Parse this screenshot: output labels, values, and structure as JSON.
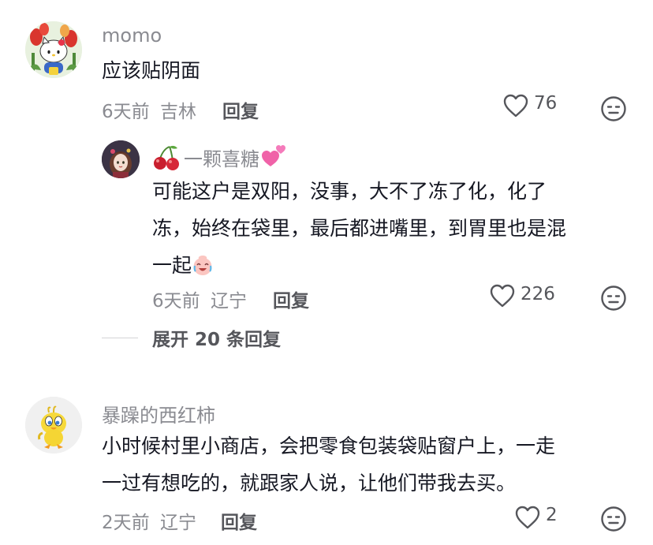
{
  "comments": [
    {
      "username": "momo",
      "text": "应该贴阴面",
      "time": "6天前",
      "location": "吉林",
      "reply_label": "回复",
      "likes": "76",
      "avatar": "hello-kitty-tulip-avatar"
    },
    {
      "username_prefix_icon": "cherry-icon",
      "username": "一颗喜糖",
      "username_suffix_icon": "two-hearts-icon",
      "text_line1": "可能这户是双阳，没事，大不了冻了化，化了",
      "text_line2": "冻，始终在袋里，最后都进嘴里，到胃里也是混",
      "text_line3": "一起",
      "text_emoji": "laughing-crying-face-icon",
      "time": "6天前",
      "location": "辽宁",
      "reply_label": "回复",
      "likes": "226",
      "avatar": "anime-girl-avatar",
      "is_reply": true
    },
    {
      "username": "暴躁的西红柿",
      "text_line1": "小时候村里小商店，会把零食包装袋贴窗户上，一走",
      "text_line2": "一过有想吃的，就跟家人说，让他们带我去买。",
      "time": "2天前",
      "location": "辽宁",
      "reply_label": "回复",
      "likes": "2",
      "avatar": "yellow-bird-avatar"
    }
  ],
  "expand_replies": "展开 20 条回复",
  "colors": {
    "text": "#161823",
    "muted": "#8a8b91",
    "action": "#55565b"
  }
}
